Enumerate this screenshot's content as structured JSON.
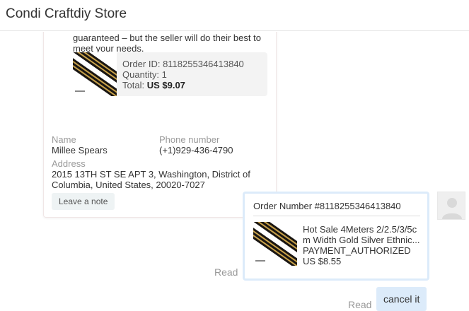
{
  "header": {
    "title": "Condi Craftdiy Store"
  },
  "seller_card": {
    "guarantee_text": "guaranteed – but the seller will do their best to meet your needs.",
    "order": {
      "order_id": "Order ID: 8118255346413840",
      "quantity": "Quantity: 1",
      "total_label": "Total:",
      "total_value": "US $9.07"
    },
    "name_label": "Name",
    "name_value": "Millee Spears",
    "phone_label": "Phone number",
    "phone_value": "(+1)929-436-4790",
    "address_label": "Address",
    "address_value": "2015 13TH ST SE APT 3, Washington, District of Columbia, United States, 20020-7027",
    "note_button": "Leave a note"
  },
  "buyer_card": {
    "order_number": "Order Number #8118255346413840",
    "product_title": "Hot Sale 4Meters 2/2.5/3/5cm Width Gold Silver Ethnic...",
    "status": "PAYMENT_AUTHORIZED",
    "price": "US $8.55",
    "read_status": "Read"
  },
  "message": {
    "text": "cancel it",
    "read_status": "Read"
  },
  "icons": {
    "avatar": "user-avatar-icon",
    "thumbnail": "product-thumbnail-icon"
  },
  "colors": {
    "buyer_bubble": "#dcebfa",
    "muted_text": "#999999"
  }
}
